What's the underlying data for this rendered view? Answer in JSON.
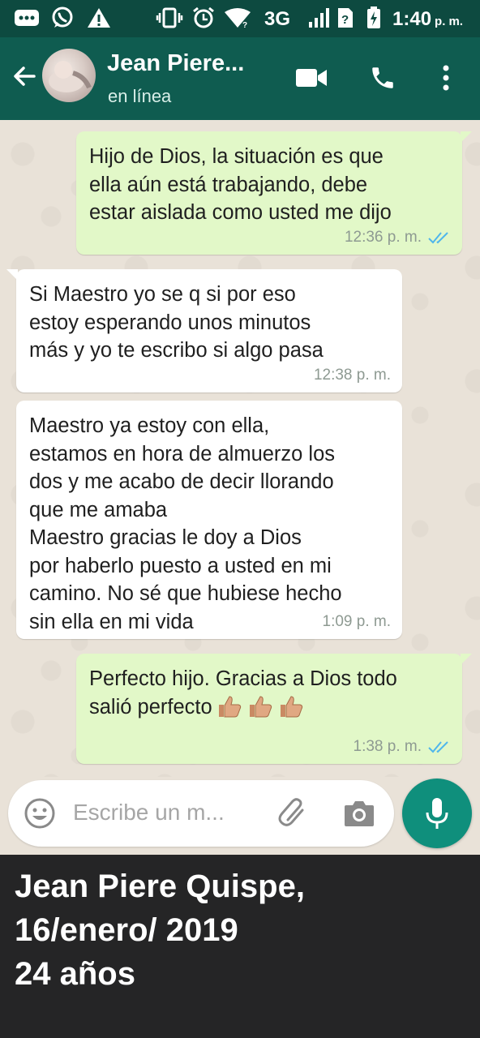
{
  "status_bar": {
    "network": "3G",
    "time": "1:40",
    "ampm": "p. m."
  },
  "header": {
    "contact_name": "Jean Piere...",
    "status": "en línea",
    "icons": [
      "back-arrow-icon",
      "video-call-icon",
      "phone-icon",
      "more-vert-icon"
    ]
  },
  "messages": [
    {
      "direction": "out",
      "text": "Hijo de Dios, la situación es que\nella aún está trabajando, debe\nestar aislada como usted me dijo",
      "time": "12:36 p. m.",
      "read": true
    },
    {
      "direction": "in",
      "text": "Si Maestro yo se q si por eso\nestoy esperando unos minutos\nmás y yo te escribo si algo pasa",
      "time": "12:38 p. m."
    },
    {
      "direction": "in",
      "text": "Maestro ya estoy con ella,\nestamos en hora de almuerzo los\ndos y me acabo de decir llorando\nque me amaba\nMaestro gracias le doy a Dios\npor haberlo puesto a usted en mi\ncamino. No sé que hubiese hecho\nsin ella en mi vida",
      "time": "1:09 p. m."
    },
    {
      "direction": "out",
      "text": "Perfecto hijo. Gracias a Dios todo\nsalió perfecto",
      "emoji": "thumbs-up-icon x3",
      "time": "1:38 p. m.",
      "read": true
    }
  ],
  "input": {
    "placeholder": "Escribe un m..."
  },
  "caption": {
    "line1": "Jean Piere Quispe,",
    "line2": "16/enero/ 2019",
    "line3": "24 años"
  },
  "colors": {
    "header": "#0f5c50",
    "status_bar": "#0d4a40",
    "outgoing_bubble": "#e2f8c8",
    "incoming_bubble": "#ffffff",
    "mic_button": "#0f8f7c",
    "read_ticks": "#4fb6ec"
  }
}
